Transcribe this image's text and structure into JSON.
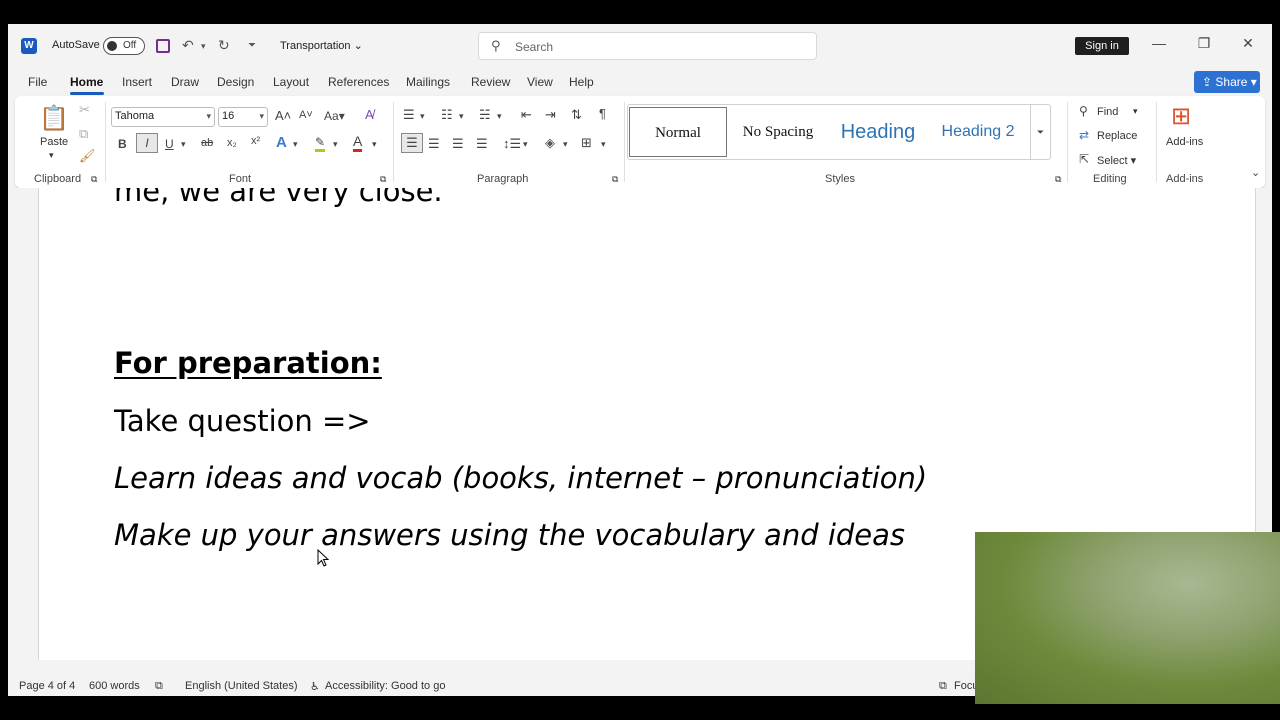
{
  "titlebar": {
    "app_logo": "W",
    "autosave_label": "AutoSave",
    "autosave_state": "Off",
    "doc_title": "Transportation",
    "search_placeholder": "Search",
    "signin": "Sign in"
  },
  "menu": {
    "items": [
      "File",
      "Home",
      "Insert",
      "Draw",
      "Design",
      "Layout",
      "References",
      "Mailings",
      "Review",
      "View",
      "Help"
    ],
    "active": "Home",
    "share": "Share"
  },
  "ribbon": {
    "clipboard": {
      "paste": "Paste",
      "label": "Clipboard"
    },
    "font": {
      "family": "Tahoma",
      "size": "16",
      "label": "Font",
      "change_case": "Aa"
    },
    "paragraph": {
      "label": "Paragraph"
    },
    "styles": {
      "normal": "Normal",
      "no_spacing": "No Spacing",
      "heading1": "Heading",
      "heading2": "Heading 2",
      "label": "Styles"
    },
    "editing": {
      "find": "Find",
      "replace": "Replace",
      "select": "Select",
      "label": "Editing"
    },
    "addins": {
      "button": "Add-ins",
      "label": "Add-ins"
    }
  },
  "document": {
    "line1": "me, we are very close.",
    "line2": "For preparation:",
    "line3": "Take question =>",
    "line4": "Learn ideas and vocab (books, internet – pronunciation)",
    "line5": "Make up your answers using the vocabulary and ideas"
  },
  "status": {
    "page": "Page 4 of 4",
    "words": "600 words",
    "language": "English (United States)",
    "accessibility": "Accessibility: Good to go",
    "focus": "Focu"
  }
}
